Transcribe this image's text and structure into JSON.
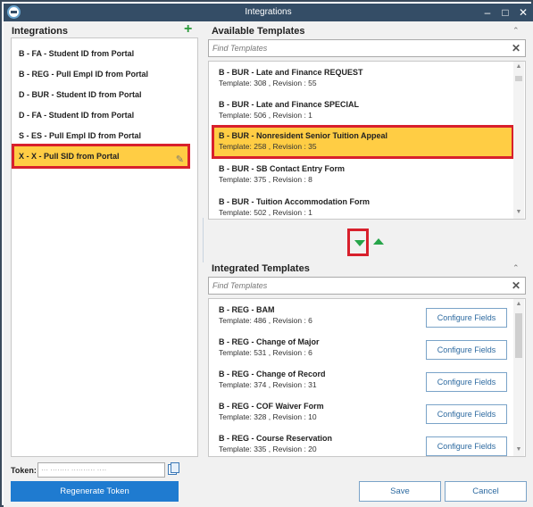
{
  "window": {
    "title": "Integrations",
    "controls": [
      "–",
      "□",
      "✕"
    ]
  },
  "integrations": {
    "title": "Integrations",
    "add_icon": "plus-icon",
    "items": [
      {
        "label": "B - FA - Student ID from Portal"
      },
      {
        "label": "B - REG - Pull Empl ID from Portal"
      },
      {
        "label": "D - BUR - Student ID from Portal"
      },
      {
        "label": "D - FA - Student ID from Portal"
      },
      {
        "label": "S - ES - Pull Empl ID from Portal"
      },
      {
        "label": "X - X - Pull SID from Portal",
        "selected": true
      }
    ]
  },
  "available": {
    "title": "Available Templates",
    "search_placeholder": "Find Templates",
    "items": [
      {
        "name": "B - BUR - Late and Finance REQUEST",
        "meta": "Template: 308 , Revision : 55"
      },
      {
        "name": "B - BUR - Late and Finance SPECIAL",
        "meta": "Template: 506 , Revision : 1"
      },
      {
        "name": "B - BUR - Nonresident Senior Tuition Appeal",
        "meta": "Template: 258 , Revision : 35",
        "selected": true
      },
      {
        "name": "B - BUR - SB Contact Entry Form",
        "meta": "Template: 375 , Revision : 8"
      },
      {
        "name": "B - BUR - Tuition Accommodation Form",
        "meta": "Template: 502 , Revision : 1"
      }
    ]
  },
  "integrated": {
    "title": "Integrated Templates",
    "search_placeholder": "Find Templates",
    "configure_label": "Configure Fields",
    "items": [
      {
        "name": "B - REG - BAM",
        "meta": "Template: 486 , Revision : 6"
      },
      {
        "name": "B - REG - Change of Major",
        "meta": "Template: 531 , Revision : 6"
      },
      {
        "name": "B - REG - Change of Record",
        "meta": "Template: 374 , Revision : 31"
      },
      {
        "name": "B - REG - COF Waiver Form",
        "meta": "Template: 328 , Revision : 10"
      },
      {
        "name": "B - REG - Course Reservation",
        "meta": "Template: 335 , Revision : 20"
      }
    ]
  },
  "token": {
    "label": "Token:",
    "value": "··· ········ ·········· ····"
  },
  "buttons": {
    "regenerate": "Regenerate Token",
    "save": "Save",
    "cancel": "Cancel"
  },
  "colors": {
    "titlebar": "#344d66",
    "selection": "#ffcd44",
    "highlight_border": "#d8202c",
    "primary": "#1f7bd0",
    "green": "#27a54a"
  }
}
